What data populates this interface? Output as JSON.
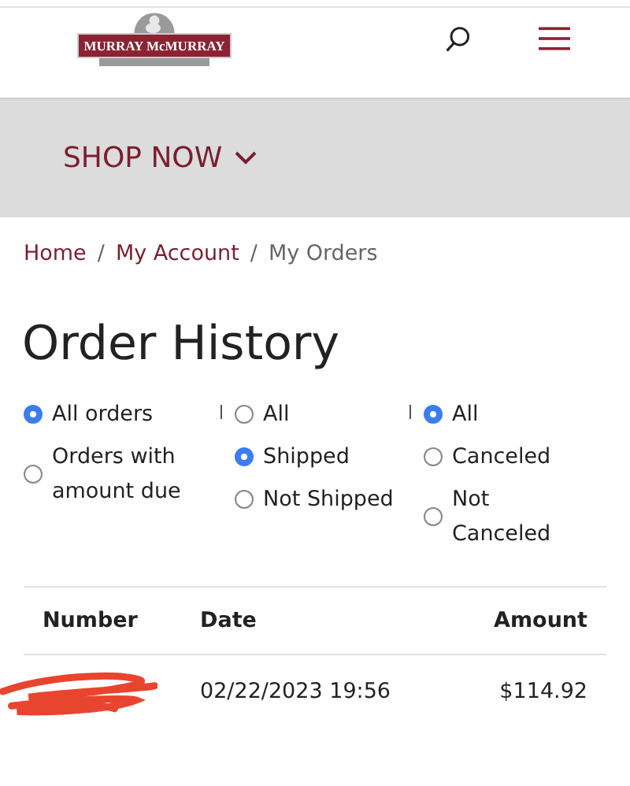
{
  "header": {
    "logo": "MURRAY McMURRAY"
  },
  "banner": {
    "label": "SHOP NOW"
  },
  "breadcrumb": [
    {
      "kind": "link",
      "label": "Home"
    },
    {
      "kind": "separator",
      "label": "/"
    },
    {
      "kind": "link",
      "label": "My Account"
    },
    {
      "kind": "separator",
      "label": "/"
    },
    {
      "kind": "current",
      "label": "My Orders"
    }
  ],
  "title": "Order History",
  "filters": [
    {
      "options": [
        {
          "label": "All orders",
          "selected": true
        },
        {
          "label": "Orders with amount due",
          "selected": false
        }
      ]
    },
    {
      "options": [
        {
          "label": "All",
          "selected": false
        },
        {
          "label": "Shipped",
          "selected": true
        },
        {
          "label": "Not Shipped",
          "selected": false
        }
      ]
    },
    {
      "options": [
        {
          "label": "All",
          "selected": true
        },
        {
          "label": "Canceled",
          "selected": false
        },
        {
          "label": "Not Canceled",
          "selected": false
        }
      ]
    }
  ],
  "table": {
    "columns": [
      "Number",
      "Date",
      "Amount"
    ],
    "rows": [
      {
        "number_redacted": true,
        "date": "02/22/2023 19:56",
        "amount": "$114.92"
      }
    ]
  }
}
